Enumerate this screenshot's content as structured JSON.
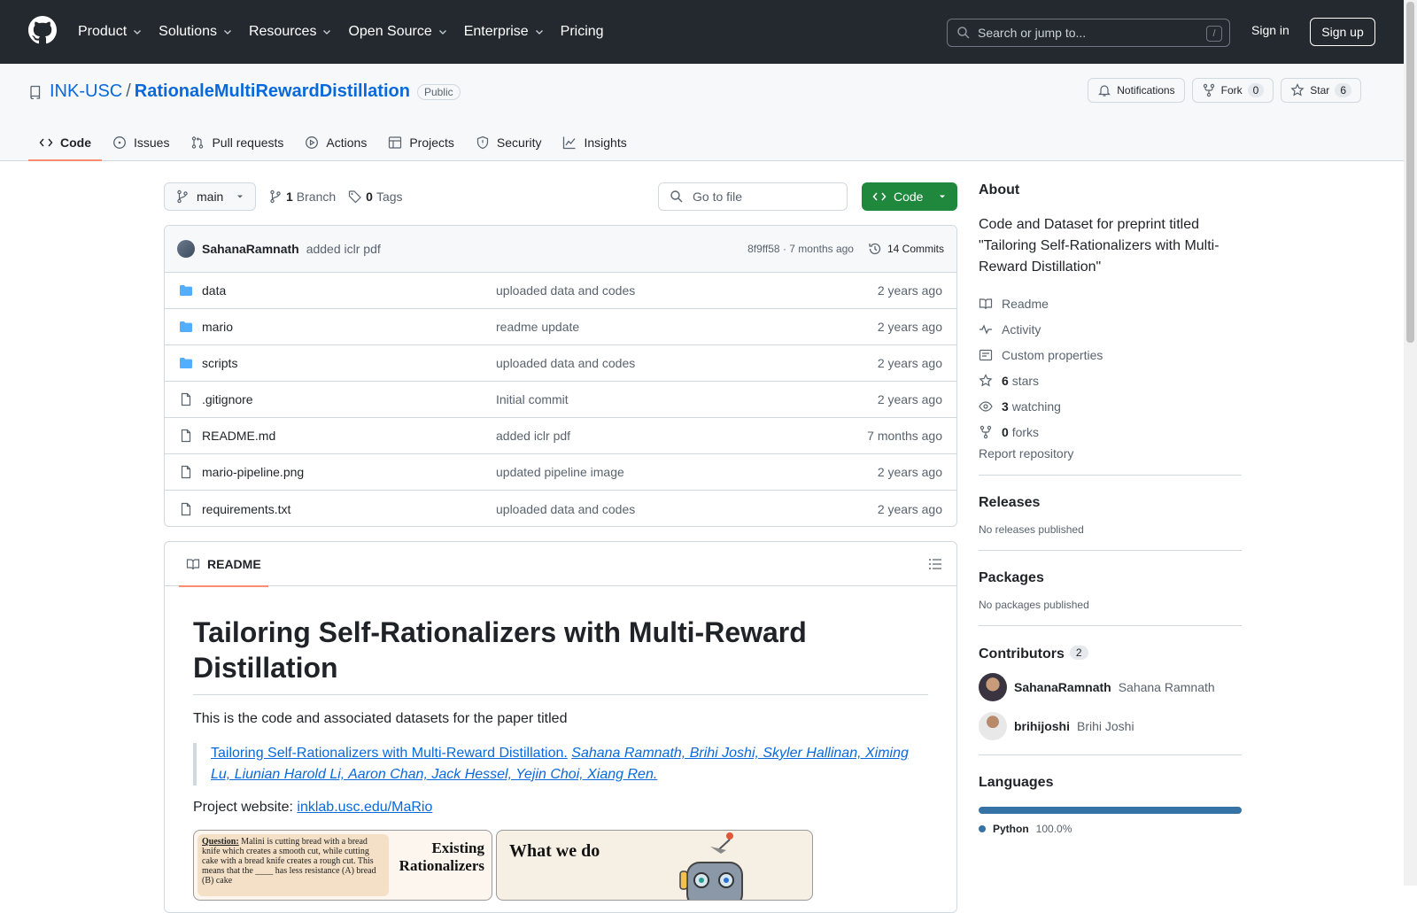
{
  "header": {
    "nav": [
      "Product",
      "Solutions",
      "Resources",
      "Open Source",
      "Enterprise",
      "Pricing"
    ],
    "search_placeholder": "Search or jump to...",
    "search_shortcut": "/",
    "sign_in": "Sign in",
    "sign_up": "Sign up"
  },
  "repo": {
    "owner": "INK-USC",
    "separator": "/",
    "name": "RationaleMultiRewardDistillation",
    "visibility": "Public",
    "notifications_label": "Notifications",
    "fork_label": "Fork",
    "fork_count": "0",
    "star_label": "Star",
    "star_count": "6",
    "tabs": [
      "Code",
      "Issues",
      "Pull requests",
      "Actions",
      "Projects",
      "Security",
      "Insights"
    ]
  },
  "toolbar": {
    "branch": "main",
    "branch_count": "1",
    "branch_label": "Branch",
    "tag_count": "0",
    "tag_label": "Tags",
    "goto_placeholder": "Go to file",
    "code_label": "Code"
  },
  "latest_commit": {
    "author": "SahanaRamnath",
    "message": "added iclr pdf",
    "meta": "8f9ff58 · 7 months ago",
    "commits": "14 Commits"
  },
  "files": [
    {
      "name": "data",
      "type": "folder",
      "message": "uploaded data and codes",
      "date": "2 years ago"
    },
    {
      "name": "mario",
      "type": "folder",
      "message": "readme update",
      "date": "2 years ago"
    },
    {
      "name": "scripts",
      "type": "folder",
      "message": "uploaded data and codes",
      "date": "2 years ago"
    },
    {
      "name": ".gitignore",
      "type": "file",
      "message": "Initial commit",
      "date": "2 years ago"
    },
    {
      "name": "README.md",
      "type": "file",
      "message": "added iclr pdf",
      "date": "7 months ago"
    },
    {
      "name": "mario-pipeline.png",
      "type": "file",
      "message": "updated pipeline image",
      "date": "2 years ago"
    },
    {
      "name": "requirements.txt",
      "type": "file",
      "message": "uploaded data and codes",
      "date": "2 years ago"
    }
  ],
  "readme": {
    "tab_label": "README",
    "title": "Tailoring Self-Rationalizers with Multi-Reward Distillation",
    "intro": "This is the code and associated datasets for the paper titled",
    "quote_link": "Tailoring Self-Rationalizers with Multi-Reward Distillation.",
    "quote_authors": "Sahana Ramnath, Brihi Joshi, Skyler Hallinan, Ximing Lu, Liunian Harold Li, Aaron Chan, Jack Hessel, Yejin Choi, Xiang Ren.",
    "website_label": "Project website:",
    "website_link": "inklab.usc.edu/MaRio",
    "figure_left_question_label": "Question:",
    "figure_left_question": "Malini is cutting bread with a bread knife which creates a smooth cut, while cutting cake with a bread knife creates a rough cut. This means that the ____ has less resistance (A) bread (B) cake",
    "figure_left_heading": "Existing Rationalizers",
    "figure_right_heading": "What we do"
  },
  "sidebar": {
    "about_title": "About",
    "about_desc": "Code and Dataset for preprint titled \"Tailoring Self-Rationalizers with Multi-Reward Distillation\"",
    "readme_link": "Readme",
    "activity_link": "Activity",
    "custom_props_link": "Custom properties",
    "stars_count": "6",
    "stars_label": "stars",
    "watching_count": "3",
    "watching_label": "watching",
    "forks_count": "0",
    "forks_label": "forks",
    "report": "Report repository",
    "releases_title": "Releases",
    "releases_text": "No releases published",
    "packages_title": "Packages",
    "packages_text": "No packages published",
    "contributors_title": "Contributors",
    "contributors_count": "2",
    "contributors": [
      {
        "login": "SahanaRamnath",
        "name": "Sahana Ramnath"
      },
      {
        "login": "brihijoshi",
        "name": "Brihi Joshi"
      }
    ],
    "languages_title": "Languages",
    "language": "Python",
    "language_pct": "100.0%",
    "language_color": "#3572A5"
  }
}
